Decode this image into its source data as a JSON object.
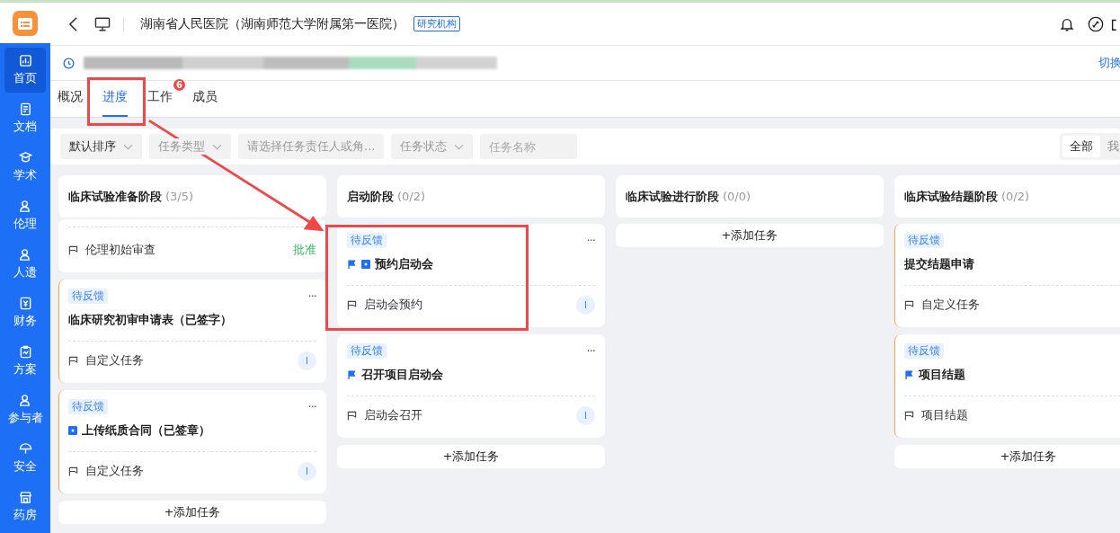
{
  "header": {
    "title": "湖南省人民医院（湖南师范大学附属第一医院）",
    "tag": "研究机构"
  },
  "sidebar": {
    "items": [
      {
        "label": "首页",
        "selected": true
      },
      {
        "label": "文档",
        "selected": false
      },
      {
        "label": "学术",
        "selected": false
      },
      {
        "label": "伦理",
        "selected": false
      },
      {
        "label": "人遗",
        "selected": false
      },
      {
        "label": "财务",
        "selected": false
      },
      {
        "label": "方案",
        "selected": false
      },
      {
        "label": "参与者",
        "selected": false
      },
      {
        "label": "安全",
        "selected": false
      },
      {
        "label": "药房",
        "selected": false
      }
    ]
  },
  "project_bar": {
    "switch_link": "切换"
  },
  "tabs": [
    {
      "label": "概况",
      "selected": false
    },
    {
      "label": "进度",
      "selected": true
    },
    {
      "label": "工作",
      "selected": false,
      "badge": "6"
    },
    {
      "label": "成员",
      "selected": false
    }
  ],
  "filters": [
    {
      "kind": "select",
      "value": "默认排序",
      "chevron": true
    },
    {
      "kind": "select",
      "placeholder": "任务类型",
      "chevron": true
    },
    {
      "kind": "select",
      "placeholder": "请选择任务责任人或角...",
      "chevron": false
    },
    {
      "kind": "select",
      "placeholder": "任务状态",
      "chevron": true
    },
    {
      "kind": "input",
      "placeholder": "任务名称"
    }
  ],
  "scope": [
    {
      "label": "全部",
      "selected": true
    },
    {
      "label": "我",
      "selected": false
    }
  ],
  "columns": [
    {
      "title": "临床试验准备阶段",
      "count": "(3/5)",
      "cards": [
        {
          "footer": "伦理初始审查",
          "result": "批准",
          "accent": false
        },
        {
          "tag": "待反馈",
          "title": "临床研究初审申请表（已签字）",
          "footer": "自定义任务",
          "avatar": "I",
          "more": "···",
          "accent": true
        },
        {
          "tag": "待反馈",
          "title": "上传纸质合同（已签章）",
          "square": true,
          "footer": "自定义任务",
          "avatar": "I",
          "more": "···",
          "accent": true
        }
      ],
      "add": "+添加任务"
    },
    {
      "title": "启动阶段",
      "count": "(0/2)",
      "cards": [
        {
          "tag": "待反馈",
          "title": "预约启动会",
          "flag": true,
          "square": true,
          "footer": "启动会预约",
          "avatar": "I",
          "more": "···",
          "accent": false
        },
        {
          "tag": "待反馈",
          "title": "召开项目启动会",
          "flag": true,
          "footer": "启动会召开",
          "avatar": "I",
          "more": "···",
          "accent": false
        }
      ],
      "add": "+添加任务"
    },
    {
      "title": "临床试验进行阶段",
      "count": "(0/0)",
      "add": "+添加任务"
    },
    {
      "title": "临床试验结题阶段",
      "count": "(0/2)",
      "cards": [
        {
          "tag": "待反馈",
          "title": "提交结题申请",
          "footer": "自定义任务",
          "accent": true
        },
        {
          "tag": "待反馈",
          "title": "项目结题",
          "flag": true,
          "footer": "项目结题",
          "accent": true
        }
      ],
      "add": "+添加任务"
    }
  ]
}
